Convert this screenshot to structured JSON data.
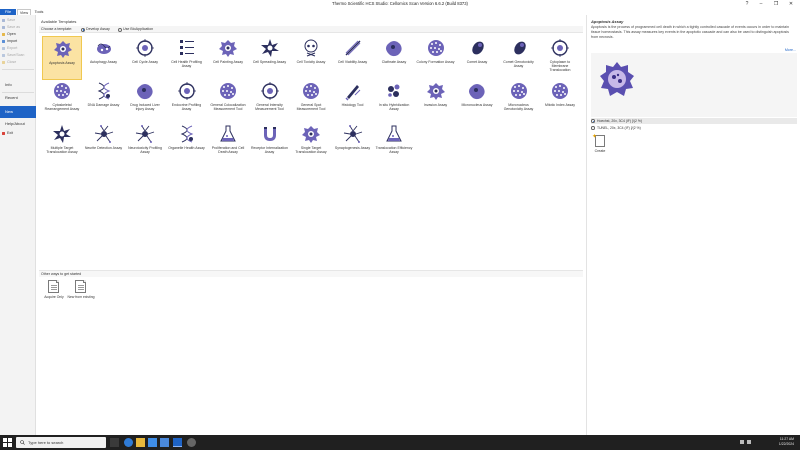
{
  "app": {
    "title": "Thermo Scientific HCS Studio: Cellomics Scan Version 6.6.2 (Build 8373)",
    "window_buttons": [
      "?",
      "–",
      "❐",
      "✕"
    ]
  },
  "menu": {
    "tabs": [
      {
        "label": "File"
      },
      {
        "label": "View"
      },
      {
        "label": "Tools"
      }
    ]
  },
  "nav": {
    "top_items": [
      {
        "label": "Save",
        "icon": "save-icon",
        "disabled": true
      },
      {
        "label": "Save as",
        "icon": "save-as-icon",
        "disabled": true
      },
      {
        "label": "Open",
        "icon": "open-folder-icon",
        "disabled": false
      },
      {
        "label": "Import",
        "icon": "import-icon",
        "disabled": false
      },
      {
        "label": "Export",
        "icon": "export-icon",
        "disabled": true
      },
      {
        "label": "Save/Scan",
        "icon": "save-scan-icon",
        "disabled": true
      },
      {
        "label": "Close",
        "icon": "close-folder-icon",
        "disabled": true
      }
    ],
    "section_items": [
      {
        "label": "Info"
      },
      {
        "label": "Recent"
      },
      {
        "label": "New",
        "selected": true
      },
      {
        "label": "Help/About"
      }
    ],
    "exit": {
      "label": "Exit",
      "icon": "exit-icon"
    }
  },
  "templates": {
    "section_title": "Available Templates",
    "choose_label": "Choose a template:",
    "options": [
      {
        "label": "Develop Assay",
        "selected": true
      },
      {
        "label": "Use BioApplication",
        "selected": false
      }
    ],
    "items": [
      {
        "label": "Apoptosis Assay",
        "selected": true
      },
      {
        "label": "Autophagy Assay"
      },
      {
        "label": "Cell Cycle Assay"
      },
      {
        "label": "Cell Health Profiling Assay"
      },
      {
        "label": "Cell Painting Assay"
      },
      {
        "label": "Cell Spreading Assay"
      },
      {
        "label": "Cell Toxicity Assay"
      },
      {
        "label": "Cell Viability Assay"
      },
      {
        "label": "Clathrate Assay"
      },
      {
        "label": "Colony Formation Assay"
      },
      {
        "label": "Comet Assay"
      },
      {
        "label": "Comet Genotoxicity Assay"
      },
      {
        "label": "Cytoplasm to Membrane Translocation"
      },
      {
        "label": "Cytoskeletal Rearrangement Assay"
      },
      {
        "label": "DNA Damage Assay"
      },
      {
        "label": "Drug Induced Liver Injury Assay"
      },
      {
        "label": "Endocrine Profiling Assay"
      },
      {
        "label": "General Colocalization Measurement Tool"
      },
      {
        "label": "General Intensity Measurement Tool"
      },
      {
        "label": "General Spot Measurement Tool"
      },
      {
        "label": "Histology Tool"
      },
      {
        "label": "In situ Hybridization Assay"
      },
      {
        "label": "Invasion Assay"
      },
      {
        "label": "Micronucleus Assay"
      },
      {
        "label": "Micronucleus Genotoxicity Assay"
      },
      {
        "label": "Mitotic Index Assay"
      },
      {
        "label": "Multiple Target Translocation Assay"
      },
      {
        "label": "Neurite Detection Assay"
      },
      {
        "label": "Neurotoxicity Profiling Assay"
      },
      {
        "label": "Organelle Health Assay"
      },
      {
        "label": "Proliferation and Cell Death Assay"
      },
      {
        "label": "Receptor Internalization Assay"
      },
      {
        "label": "Single Target Translocation Assay"
      },
      {
        "label": "Synaptogenesis Assay"
      },
      {
        "label": "Translocation Efficiency Assay"
      }
    ]
  },
  "other_ways": {
    "title": "Other ways to get started",
    "items": [
      {
        "label": "Acquire Only"
      },
      {
        "label": "New from existing"
      }
    ]
  },
  "detail": {
    "title": "Apoptosis Assay",
    "description": "Apoptosis is the process of programmed cell death in which a tightly controlled cascade of events occurs in order to maintain tissue homeostasis. This assay measures key events in the apoptotic cascade and can also be used to distinguish apoptosis from necrosis.",
    "more_link": "More...",
    "channels": [
      {
        "label": "Hoechst, 20x, 3C4 (IF) [/(2 %)",
        "selected": true
      },
      {
        "label": "TUNEL, 20x, 3C4 (IF) [/(2 %)",
        "selected": false
      }
    ],
    "create_label": "Create"
  },
  "taskbar": {
    "search_placeholder": "Type here to search",
    "time": "11:27 AM",
    "date": "1/22/2024"
  },
  "colors": {
    "accent": "#1e63c6",
    "selected_tile": "#fbe3a3",
    "icon_ink": "#2c2f5e",
    "icon_fill": "#6c63b8"
  }
}
